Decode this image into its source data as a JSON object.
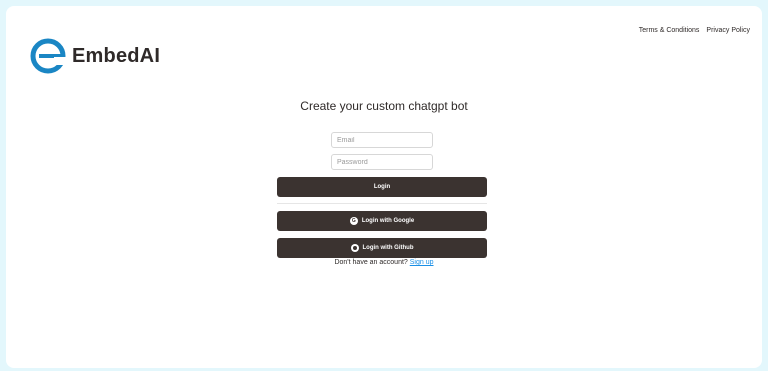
{
  "brand": {
    "name": "EmbedAI",
    "colors": {
      "logo_blue": "#1a86c4",
      "dark": "#3b3330",
      "background": "#e3f7fc",
      "link": "#1a8fe6"
    }
  },
  "header": {
    "links": [
      "Terms & Conditions",
      "Privacy Policy"
    ]
  },
  "main": {
    "heading": "Create your custom chatgpt bot",
    "email_placeholder": "Email",
    "password_placeholder": "Password",
    "login_label": "Login",
    "google_label": "Login with Google",
    "google_icon": "google-icon",
    "github_label": "Login with Github",
    "github_icon": "github-icon"
  },
  "footer": {
    "prompt": "Don't have an account?",
    "signup_label": "Sign up"
  }
}
